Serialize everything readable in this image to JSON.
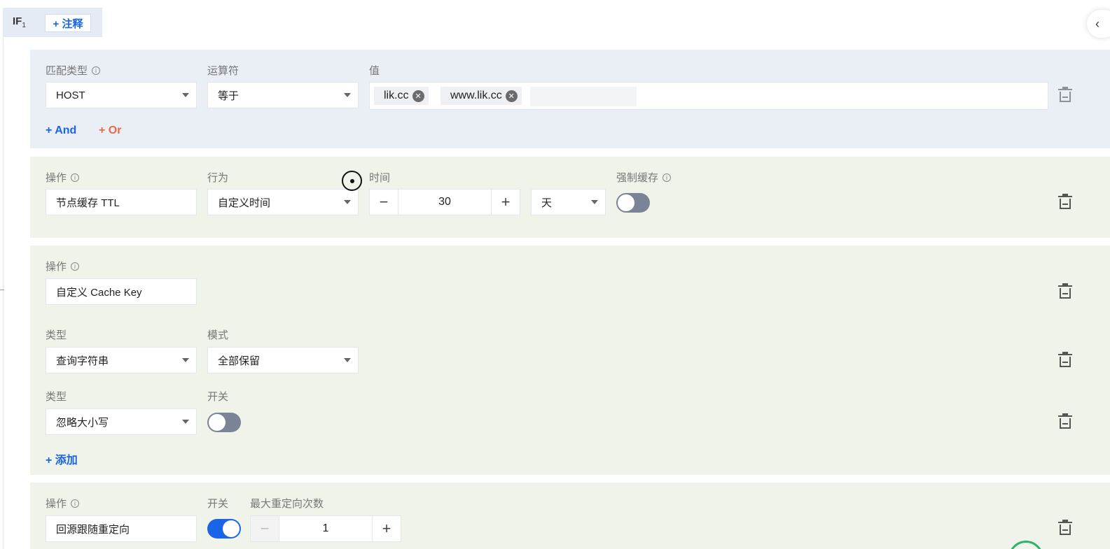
{
  "header": {
    "if_label": "IF",
    "if_index": "1",
    "add_note_label": "+ 注释"
  },
  "condition": {
    "match_type": {
      "label": "匹配类型",
      "value": "HOST"
    },
    "operator": {
      "label": "运算符",
      "value": "等于"
    },
    "value": {
      "label": "值",
      "tags": [
        "lik.cc",
        "www.lik.cc"
      ]
    },
    "and_label": "+ And",
    "or_label": "+ Or"
  },
  "ttl_action": {
    "operation": {
      "label": "操作",
      "value": "节点缓存 TTL"
    },
    "behavior": {
      "label": "行为",
      "value": "自定义时间"
    },
    "time": {
      "label": "时间",
      "value": "30",
      "minus": "−",
      "plus": "+"
    },
    "unit": {
      "value": "天"
    },
    "force_cache": {
      "label": "强制缓存",
      "on": false
    }
  },
  "cache_key_action": {
    "operation": {
      "label": "操作",
      "value": "自定义 Cache Key"
    },
    "row1": {
      "type_label": "类型",
      "type_value": "查询字符串",
      "mode_label": "模式",
      "mode_value": "全部保留"
    },
    "row2": {
      "type_label": "类型",
      "type_value": "忽略大小写",
      "switch_label": "开关",
      "switch_on": false
    },
    "add_label": "+ 添加"
  },
  "redirect_action": {
    "operation": {
      "label": "操作",
      "value": "回源跟随重定向"
    },
    "switch": {
      "label": "开关",
      "on": true
    },
    "max_redirects": {
      "label": "最大重定向次数",
      "value": "1",
      "minus": "−",
      "plus": "+"
    }
  }
}
